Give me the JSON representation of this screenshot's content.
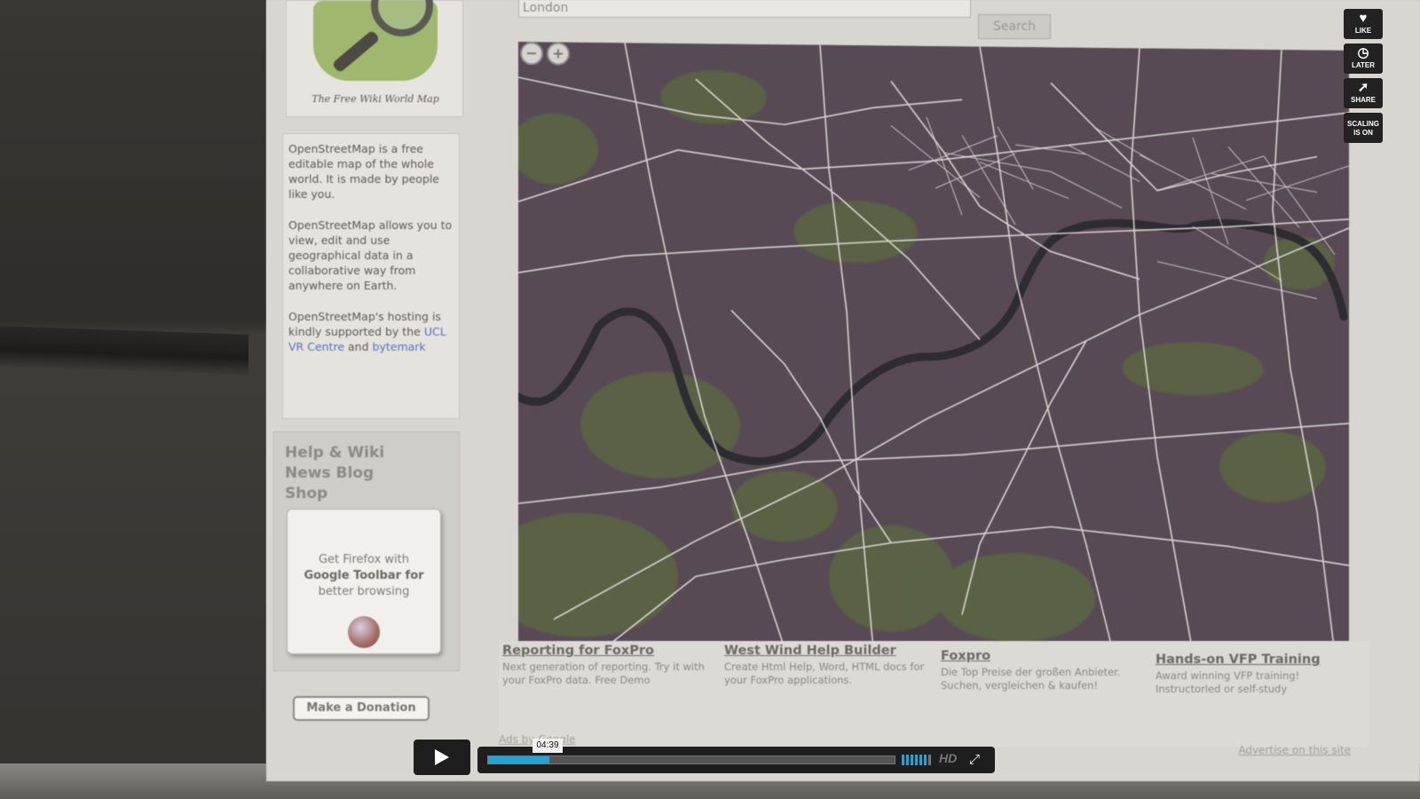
{
  "osm": {
    "logo_caption": "The Free Wiki World Map",
    "intro_p1": "OpenStreetMap is a free editable map of the whole world. It is made by people like you.",
    "intro_p2": "OpenStreetMap allows you to view, edit and use geographical data in a collaborative way from anywhere on Earth.",
    "intro_p3_prefix": "OpenStreetMap's hosting is kindly supported by the",
    "intro_link1": "UCL VR Centre",
    "intro_and": "and",
    "intro_link2": "bytemark",
    "help_links": [
      "Help & Wiki",
      "News Blog",
      "Shop"
    ],
    "firefox_promo_line1": "Get Firefox with",
    "firefox_promo_line2": "Google Toolbar for",
    "firefox_promo_line3": "better browsing",
    "donate_label": "Make a Donation",
    "search_value": "London",
    "search_button": "Search",
    "zoom_out": "−",
    "zoom_in": "+",
    "ads": [
      {
        "title": "Reporting for FoxPro",
        "body": "Next generation of reporting. Try it with your FoxPro data. Free Demo"
      },
      {
        "title": "West Wind Help Builder",
        "body": "Create Html Help, Word, HTML docs for your FoxPro applications."
      },
      {
        "title": "Foxpro",
        "body": "Die Top Preise der großen Anbieter. Suchen, vergleichen & kaufen!"
      },
      {
        "title": "Hands-on VFP Training",
        "body": "Award winning VFP training! Instructorled or self-study"
      }
    ],
    "ads_footer_left": "Ads by Google",
    "ads_footer_right": "Advertise on this site"
  },
  "player": {
    "side_buttons": [
      {
        "icon": "heart-icon",
        "glyph": "♥",
        "label": "LIKE"
      },
      {
        "icon": "clock-icon",
        "glyph": "◷",
        "label": "LATER"
      },
      {
        "icon": "share-icon",
        "glyph": "➚",
        "label": "SHARE"
      },
      {
        "icon": "scaling-icon",
        "glyph": "",
        "label": "SCALING IS ON"
      }
    ],
    "time": "04:39",
    "progress": 0.15,
    "hd_label": "HD",
    "accent": "#1ea5d8"
  }
}
